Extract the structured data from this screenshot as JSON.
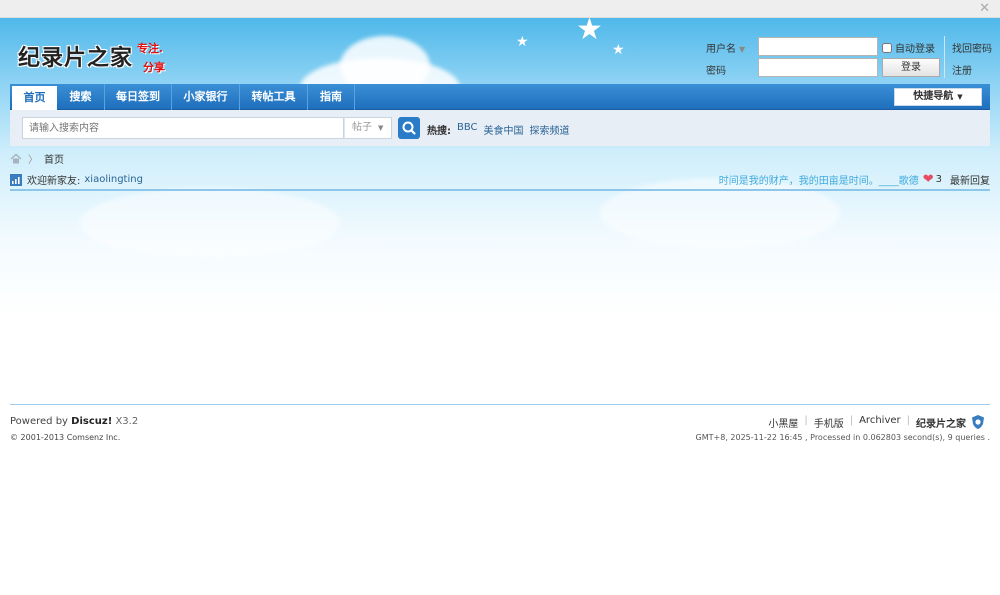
{
  "window": {
    "close_glyph": "✕"
  },
  "logo": {
    "main": "纪录片之家",
    "tag1": "专注.",
    "tag2": "分享"
  },
  "login": {
    "username_label": "用户名",
    "password_label": "密码",
    "auto_login_label": "自动登录",
    "login_button": "登录",
    "find_password": "找回密码",
    "register": "注册"
  },
  "nav": {
    "items": [
      {
        "label": "首页"
      },
      {
        "label": "搜索"
      },
      {
        "label": "每日签到"
      },
      {
        "label": "小家银行"
      },
      {
        "label": "转帖工具"
      },
      {
        "label": "指南"
      }
    ],
    "quick_nav": "快捷导航"
  },
  "search": {
    "placeholder": "请输入搜索内容",
    "type": "帖子",
    "hot_label": "热搜:",
    "hot_items": [
      "BBC",
      "美食中国",
      "探索频道"
    ]
  },
  "breadcrumb": {
    "current": "首页"
  },
  "welcome": {
    "text": "欢迎新家友:",
    "user": "xiaolingting"
  },
  "announce": {
    "motto": "时间是我的财产，我的田亩是时间。____歌德",
    "likes": "3",
    "latest": "最新回复"
  },
  "footer": {
    "powered_prefix": "Powered by",
    "powered_brand": "Discuz!",
    "version": "X3.2",
    "copyright": "© 2001-2013 Comsenz Inc.",
    "links": [
      "小黑屋",
      "手机版",
      "Archiver",
      "纪录片之家"
    ],
    "processed": "GMT+8, 2025-11-22 16:45 , Processed in 0.062803 second(s), 9 queries ."
  },
  "colors": {
    "nav_blue": "#1f6fbd",
    "link_blue": "#2a6496",
    "heart": "#e84a5f"
  },
  "icons": [
    "close-icon",
    "home-icon",
    "search-icon",
    "stats-icon",
    "heart-icon",
    "shield-icon"
  ]
}
